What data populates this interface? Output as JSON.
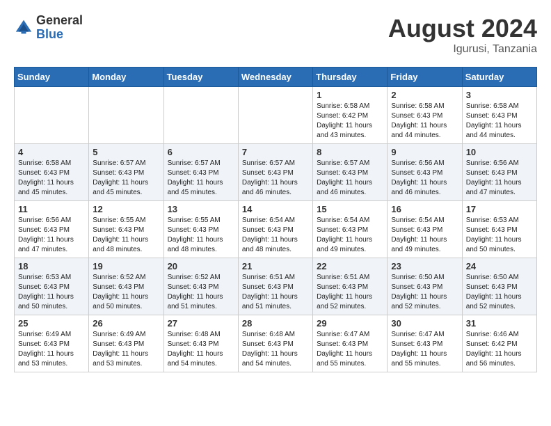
{
  "header": {
    "logo_general": "General",
    "logo_blue": "Blue",
    "month_year": "August 2024",
    "location": "Igurusi, Tanzania"
  },
  "days_of_week": [
    "Sunday",
    "Monday",
    "Tuesday",
    "Wednesday",
    "Thursday",
    "Friday",
    "Saturday"
  ],
  "weeks": [
    [
      {
        "day": "",
        "content": ""
      },
      {
        "day": "",
        "content": ""
      },
      {
        "day": "",
        "content": ""
      },
      {
        "day": "",
        "content": ""
      },
      {
        "day": "1",
        "content": "Sunrise: 6:58 AM\nSunset: 6:42 PM\nDaylight: 11 hours\nand 43 minutes."
      },
      {
        "day": "2",
        "content": "Sunrise: 6:58 AM\nSunset: 6:43 PM\nDaylight: 11 hours\nand 44 minutes."
      },
      {
        "day": "3",
        "content": "Sunrise: 6:58 AM\nSunset: 6:43 PM\nDaylight: 11 hours\nand 44 minutes."
      }
    ],
    [
      {
        "day": "4",
        "content": "Sunrise: 6:58 AM\nSunset: 6:43 PM\nDaylight: 11 hours\nand 45 minutes."
      },
      {
        "day": "5",
        "content": "Sunrise: 6:57 AM\nSunset: 6:43 PM\nDaylight: 11 hours\nand 45 minutes."
      },
      {
        "day": "6",
        "content": "Sunrise: 6:57 AM\nSunset: 6:43 PM\nDaylight: 11 hours\nand 45 minutes."
      },
      {
        "day": "7",
        "content": "Sunrise: 6:57 AM\nSunset: 6:43 PM\nDaylight: 11 hours\nand 46 minutes."
      },
      {
        "day": "8",
        "content": "Sunrise: 6:57 AM\nSunset: 6:43 PM\nDaylight: 11 hours\nand 46 minutes."
      },
      {
        "day": "9",
        "content": "Sunrise: 6:56 AM\nSunset: 6:43 PM\nDaylight: 11 hours\nand 46 minutes."
      },
      {
        "day": "10",
        "content": "Sunrise: 6:56 AM\nSunset: 6:43 PM\nDaylight: 11 hours\nand 47 minutes."
      }
    ],
    [
      {
        "day": "11",
        "content": "Sunrise: 6:56 AM\nSunset: 6:43 PM\nDaylight: 11 hours\nand 47 minutes."
      },
      {
        "day": "12",
        "content": "Sunrise: 6:55 AM\nSunset: 6:43 PM\nDaylight: 11 hours\nand 48 minutes."
      },
      {
        "day": "13",
        "content": "Sunrise: 6:55 AM\nSunset: 6:43 PM\nDaylight: 11 hours\nand 48 minutes."
      },
      {
        "day": "14",
        "content": "Sunrise: 6:54 AM\nSunset: 6:43 PM\nDaylight: 11 hours\nand 48 minutes."
      },
      {
        "day": "15",
        "content": "Sunrise: 6:54 AM\nSunset: 6:43 PM\nDaylight: 11 hours\nand 49 minutes."
      },
      {
        "day": "16",
        "content": "Sunrise: 6:54 AM\nSunset: 6:43 PM\nDaylight: 11 hours\nand 49 minutes."
      },
      {
        "day": "17",
        "content": "Sunrise: 6:53 AM\nSunset: 6:43 PM\nDaylight: 11 hours\nand 50 minutes."
      }
    ],
    [
      {
        "day": "18",
        "content": "Sunrise: 6:53 AM\nSunset: 6:43 PM\nDaylight: 11 hours\nand 50 minutes."
      },
      {
        "day": "19",
        "content": "Sunrise: 6:52 AM\nSunset: 6:43 PM\nDaylight: 11 hours\nand 50 minutes."
      },
      {
        "day": "20",
        "content": "Sunrise: 6:52 AM\nSunset: 6:43 PM\nDaylight: 11 hours\nand 51 minutes."
      },
      {
        "day": "21",
        "content": "Sunrise: 6:51 AM\nSunset: 6:43 PM\nDaylight: 11 hours\nand 51 minutes."
      },
      {
        "day": "22",
        "content": "Sunrise: 6:51 AM\nSunset: 6:43 PM\nDaylight: 11 hours\nand 52 minutes."
      },
      {
        "day": "23",
        "content": "Sunrise: 6:50 AM\nSunset: 6:43 PM\nDaylight: 11 hours\nand 52 minutes."
      },
      {
        "day": "24",
        "content": "Sunrise: 6:50 AM\nSunset: 6:43 PM\nDaylight: 11 hours\nand 52 minutes."
      }
    ],
    [
      {
        "day": "25",
        "content": "Sunrise: 6:49 AM\nSunset: 6:43 PM\nDaylight: 11 hours\nand 53 minutes."
      },
      {
        "day": "26",
        "content": "Sunrise: 6:49 AM\nSunset: 6:43 PM\nDaylight: 11 hours\nand 53 minutes."
      },
      {
        "day": "27",
        "content": "Sunrise: 6:48 AM\nSunset: 6:43 PM\nDaylight: 11 hours\nand 54 minutes."
      },
      {
        "day": "28",
        "content": "Sunrise: 6:48 AM\nSunset: 6:43 PM\nDaylight: 11 hours\nand 54 minutes."
      },
      {
        "day": "29",
        "content": "Sunrise: 6:47 AM\nSunset: 6:43 PM\nDaylight: 11 hours\nand 55 minutes."
      },
      {
        "day": "30",
        "content": "Sunrise: 6:47 AM\nSunset: 6:43 PM\nDaylight: 11 hours\nand 55 minutes."
      },
      {
        "day": "31",
        "content": "Sunrise: 6:46 AM\nSunset: 6:42 PM\nDaylight: 11 hours\nand 56 minutes."
      }
    ]
  ]
}
